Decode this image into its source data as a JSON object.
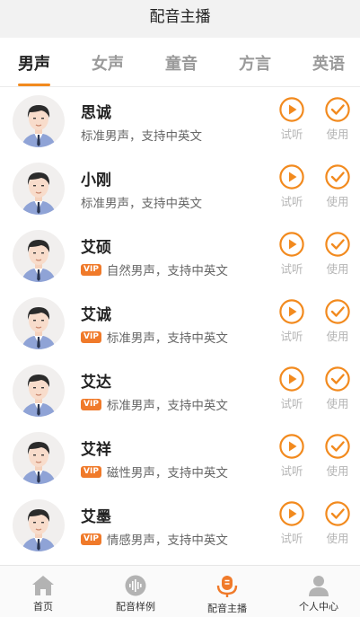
{
  "header": {
    "title": "配音主播"
  },
  "tabs": [
    {
      "label": "男声"
    },
    {
      "label": "女声"
    },
    {
      "label": "童音"
    },
    {
      "label": "方言"
    },
    {
      "label": "英语"
    }
  ],
  "colors": {
    "accent": "#f28a1e",
    "vip": "#f07a2a"
  },
  "voices": [
    {
      "name": "思诚",
      "vip": "",
      "desc": "标准男声，支持中英文",
      "listen_label": "试听",
      "use_label": "使用"
    },
    {
      "name": "小刚",
      "vip": "",
      "desc": "标准男声，支持中英文",
      "listen_label": "试听",
      "use_label": "使用"
    },
    {
      "name": "艾硕",
      "vip": "VIP",
      "desc": "自然男声，支持中英文",
      "listen_label": "试听",
      "use_label": "使用"
    },
    {
      "name": "艾诚",
      "vip": "VIP",
      "desc": "标准男声，支持中英文",
      "listen_label": "试听",
      "use_label": "使用"
    },
    {
      "name": "艾达",
      "vip": "VIP",
      "desc": "标准男声，支持中英文",
      "listen_label": "试听",
      "use_label": "使用"
    },
    {
      "name": "艾祥",
      "vip": "VIP",
      "desc": "磁性男声，支持中英文",
      "listen_label": "试听",
      "use_label": "使用"
    },
    {
      "name": "艾墨",
      "vip": "VIP",
      "desc": "情感男声，支持中英文",
      "listen_label": "试听",
      "use_label": "使用"
    }
  ],
  "bottom_nav": [
    {
      "label": "首页",
      "icon": "home-icon"
    },
    {
      "label": "配音样例",
      "icon": "waveform-icon"
    },
    {
      "label": "配音主播",
      "icon": "microphone-icon"
    },
    {
      "label": "个人中心",
      "icon": "person-icon"
    }
  ]
}
